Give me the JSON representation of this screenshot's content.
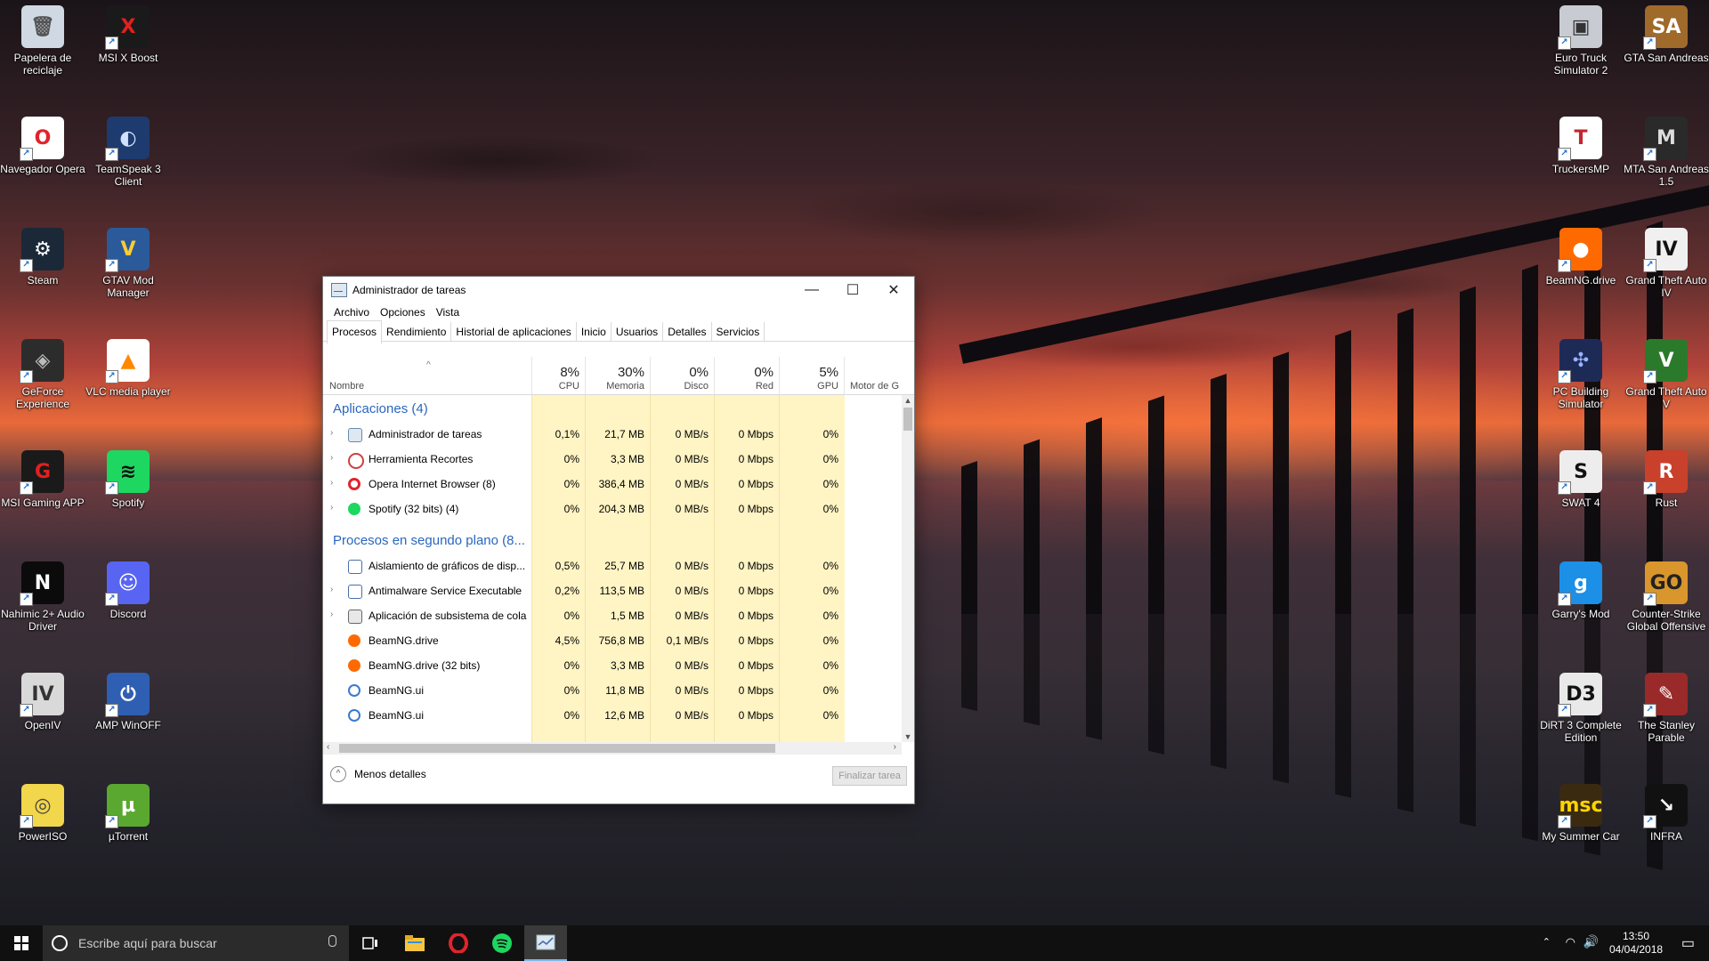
{
  "desktop": {
    "icons": [
      {
        "label": "Papelera de reciclaje",
        "glyph": "🗑",
        "bg": "#cfd8e3",
        "fg": "#555"
      },
      {
        "label": "MSI X Boost",
        "glyph": "X",
        "bg": "#1a1a1a",
        "fg": "#e02020"
      },
      {
        "label": "Navegador Opera",
        "glyph": "O",
        "bg": "#ffffff",
        "fg": "#e0242c"
      },
      {
        "label": "TeamSpeak 3 Client",
        "glyph": "◐",
        "bg": "#1d3b6e",
        "fg": "#cfe1ff"
      },
      {
        "label": "Steam",
        "glyph": "⚙",
        "bg": "#1b2838",
        "fg": "#ffffff"
      },
      {
        "label": "GTAV Mod Manager",
        "glyph": "V",
        "bg": "#2a5a9a",
        "fg": "#ffcc33"
      },
      {
        "label": "GeForce Experience",
        "glyph": "◈",
        "bg": "#2c2c2c",
        "fg": "#bbbbbb"
      },
      {
        "label": "VLC media player",
        "glyph": "▲",
        "bg": "#ffffff",
        "fg": "#ff8800"
      },
      {
        "label": "MSI Gaming APP",
        "glyph": "G",
        "bg": "#1a1a1a",
        "fg": "#e02020"
      },
      {
        "label": "Spotify",
        "glyph": "≋",
        "bg": "#1ed760",
        "fg": "#0b0b0b"
      },
      {
        "label": "Nahimic 2+ Audio Driver",
        "glyph": "N",
        "bg": "#0b0b0b",
        "fg": "#ffffff"
      },
      {
        "label": "Discord",
        "glyph": "☺",
        "bg": "#5865f2",
        "fg": "#ffffff"
      },
      {
        "label": "OpenIV",
        "glyph": "IV",
        "bg": "#d9d9d9",
        "fg": "#333"
      },
      {
        "label": "AMP WinOFF",
        "glyph": "⏻",
        "bg": "#2f5fb3",
        "fg": "#ffffff"
      },
      {
        "label": "PowerISO",
        "glyph": "◎",
        "bg": "#f2d64b",
        "fg": "#444"
      },
      {
        "label": "µTorrent",
        "glyph": "µ",
        "bg": "#5aa830",
        "fg": "#ffffff"
      },
      {
        "label": "Euro Truck Simulator 2",
        "glyph": "▣",
        "bg": "#c8ccd2",
        "fg": "#333"
      },
      {
        "label": "GTA San Andreas",
        "glyph": "SA",
        "bg": "#a06a2a",
        "fg": "#ffffff"
      },
      {
        "label": "TruckersMP",
        "glyph": "T",
        "bg": "#ffffff",
        "fg": "#c0272d"
      },
      {
        "label": "MTA San Andreas 1.5",
        "glyph": "M",
        "bg": "#2a2a2a",
        "fg": "#dddddd"
      },
      {
        "label": "BeamNG.drive",
        "glyph": "●",
        "bg": "#ff6a00",
        "fg": "#ffffff"
      },
      {
        "label": "Grand Theft Auto IV",
        "glyph": "IV",
        "bg": "#f0f0f0",
        "fg": "#111"
      },
      {
        "label": "PC Building Simulator",
        "glyph": "✣",
        "bg": "#1e2a56",
        "fg": "#9ab3ff"
      },
      {
        "label": "Grand Theft Auto V",
        "glyph": "V",
        "bg": "#2b7a2b",
        "fg": "#ffffff"
      },
      {
        "label": "SWAT 4",
        "glyph": "S",
        "bg": "#ededed",
        "fg": "#111"
      },
      {
        "label": "Rust",
        "glyph": "R",
        "bg": "#c9412b",
        "fg": "#ffffff"
      },
      {
        "label": "Garry's Mod",
        "glyph": "g",
        "bg": "#1c8fe6",
        "fg": "#ffffff"
      },
      {
        "label": "Counter-Strike Global Offensive",
        "glyph": "GO",
        "bg": "#d9962c",
        "fg": "#222"
      },
      {
        "label": "DiRT 3 Complete Edition",
        "glyph": "D3",
        "bg": "#e9e9e9",
        "fg": "#111"
      },
      {
        "label": "The Stanley Parable",
        "glyph": "✎",
        "bg": "#9a2a2a",
        "fg": "#ffffff"
      },
      {
        "label": "My Summer Car",
        "glyph": "msc",
        "bg": "#3a2a10",
        "fg": "#ffd400"
      },
      {
        "label": "INFRA",
        "glyph": "↘",
        "bg": "#111111",
        "fg": "#ffffff"
      }
    ]
  },
  "taskmgr": {
    "title": "Administrador de tareas",
    "controls": {
      "minimize": "—",
      "maximize": "☐",
      "close": "✕"
    },
    "menu": [
      "Archivo",
      "Opciones",
      "Vista"
    ],
    "tabs": [
      "Procesos",
      "Rendimiento",
      "Historial de aplicaciones",
      "Inicio",
      "Usuarios",
      "Detalles",
      "Servicios"
    ],
    "header": {
      "name": "Nombre",
      "cpu_pct": "8%",
      "cpu": "CPU",
      "mem_pct": "30%",
      "mem": "Memoria",
      "disk_pct": "0%",
      "disk": "Disco",
      "net_pct": "0%",
      "net": "Red",
      "gpu_pct": "5%",
      "gpu": "GPU",
      "gpu_engine": "Motor de G"
    },
    "groups": [
      {
        "title": "Aplicaciones (4)",
        "rows": [
          {
            "expand": true,
            "icon": "taskmgr",
            "name": "Administrador de tareas",
            "cpu": "0,1%",
            "mem": "21,7 MB",
            "disk": "0 MB/s",
            "net": "0 Mbps",
            "gpu": "0%"
          },
          {
            "expand": true,
            "icon": "snip",
            "name": "Herramienta Recortes",
            "cpu": "0%",
            "mem": "3,3 MB",
            "disk": "0 MB/s",
            "net": "0 Mbps",
            "gpu": "0%"
          },
          {
            "expand": true,
            "icon": "opera",
            "name": "Opera Internet Browser (8)",
            "cpu": "0%",
            "mem": "386,4 MB",
            "disk": "0 MB/s",
            "net": "0 Mbps",
            "gpu": "0%"
          },
          {
            "expand": true,
            "icon": "spotify",
            "name": "Spotify (32 bits) (4)",
            "cpu": "0%",
            "mem": "204,3 MB",
            "disk": "0 MB/s",
            "net": "0 Mbps",
            "gpu": "0%"
          }
        ]
      },
      {
        "title": "Procesos en segundo plano (8...",
        "rows": [
          {
            "expand": false,
            "icon": "win",
            "name": "Aislamiento de gráficos de disp...",
            "cpu": "0,5%",
            "mem": "25,7 MB",
            "disk": "0 MB/s",
            "net": "0 Mbps",
            "gpu": "0%"
          },
          {
            "expand": true,
            "icon": "win",
            "name": "Antimalware Service Executable",
            "cpu": "0,2%",
            "mem": "113,5 MB",
            "disk": "0 MB/s",
            "net": "0 Mbps",
            "gpu": "0%"
          },
          {
            "expand": true,
            "icon": "printer",
            "name": "Aplicación de subsistema de cola",
            "cpu": "0%",
            "mem": "1,5 MB",
            "disk": "0 MB/s",
            "net": "0 Mbps",
            "gpu": "0%"
          },
          {
            "expand": false,
            "icon": "beamng",
            "name": "BeamNG.drive",
            "cpu": "4,5%",
            "mem": "756,8 MB",
            "disk": "0,1 MB/s",
            "net": "0 Mbps",
            "gpu": "0%"
          },
          {
            "expand": false,
            "icon": "beamng",
            "name": "BeamNG.drive (32 bits)",
            "cpu": "0%",
            "mem": "3,3 MB",
            "disk": "0 MB/s",
            "net": "0 Mbps",
            "gpu": "0%"
          },
          {
            "expand": false,
            "icon": "beamui",
            "name": "BeamNG.ui",
            "cpu": "0%",
            "mem": "11,8 MB",
            "disk": "0 MB/s",
            "net": "0 Mbps",
            "gpu": "0%"
          },
          {
            "expand": false,
            "icon": "beamui",
            "name": "BeamNG.ui",
            "cpu": "0%",
            "mem": "12,6 MB",
            "disk": "0 MB/s",
            "net": "0 Mbps",
            "gpu": "0%"
          }
        ]
      }
    ],
    "footer": {
      "fewer_details": "Menos detalles",
      "end_task": "Finalizar tarea"
    }
  },
  "taskbar": {
    "search_placeholder": "Escribe aquí para buscar",
    "clock_time": "13:50",
    "clock_date": "04/04/2018",
    "pinned": [
      "task-view",
      "file-explorer",
      "opera",
      "spotify",
      "task-manager"
    ]
  },
  "colors": {
    "accent": "#2a66c0",
    "heat": "#fff4c4",
    "taskbar": "#101010"
  }
}
